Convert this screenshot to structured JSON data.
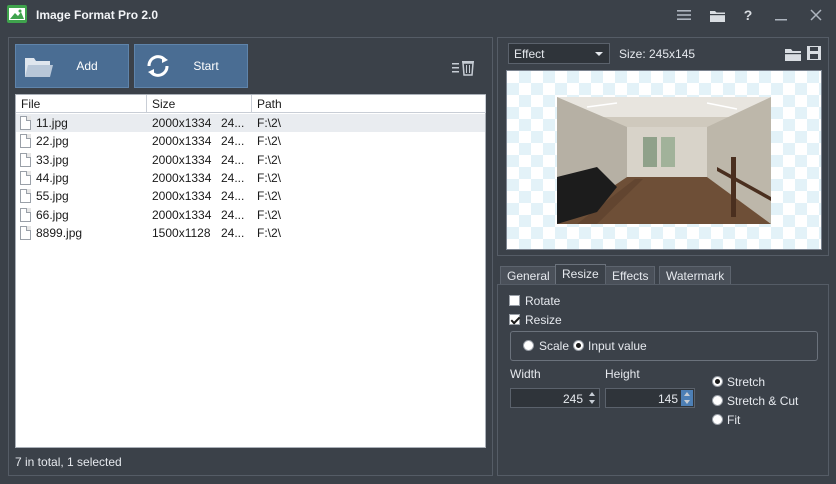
{
  "app": {
    "title": "Image Format Pro 2.0"
  },
  "toolbar": {
    "add_label": "Add",
    "start_label": "Start"
  },
  "file_table": {
    "columns": [
      "File",
      "Size",
      "Path"
    ],
    "rows": [
      {
        "file": "11.jpg",
        "size": "2000x1334",
        "bytes": "24...",
        "path": "F:\\2\\"
      },
      {
        "file": "22.jpg",
        "size": "2000x1334",
        "bytes": "24...",
        "path": "F:\\2\\"
      },
      {
        "file": "33.jpg",
        "size": "2000x1334",
        "bytes": "24...",
        "path": "F:\\2\\"
      },
      {
        "file": "44.jpg",
        "size": "2000x1334",
        "bytes": "24...",
        "path": "F:\\2\\"
      },
      {
        "file": "55.jpg",
        "size": "2000x1334",
        "bytes": "24...",
        "path": "F:\\2\\"
      },
      {
        "file": "66.jpg",
        "size": "2000x1334",
        "bytes": "24...",
        "path": "F:\\2\\"
      },
      {
        "file": "8899.jpg",
        "size": "1500x1128",
        "bytes": "24...",
        "path": "F:\\2\\"
      }
    ],
    "selected_index": 0
  },
  "status": {
    "text": "7 in total, 1 selected"
  },
  "preview": {
    "mode_select": "Effect",
    "size_label": "Size: 245x145"
  },
  "tabs": [
    "General",
    "Resize",
    "Effects",
    "Watermark"
  ],
  "active_tab": "Resize",
  "resize": {
    "rotate_label": "Rotate",
    "rotate_checked": false,
    "resize_label": "Resize",
    "resize_checked": true,
    "scale_label": "Scale",
    "input_value_label": "Input value",
    "mode": "Input value",
    "width_label": "Width",
    "height_label": "Height",
    "width_value": "245",
    "height_value": "145",
    "fit_options": [
      "Stretch",
      "Stretch & Cut",
      "Fit"
    ],
    "fit_selected": "Stretch"
  },
  "icons": {
    "menu": "menu-icon",
    "folder": "folder-icon",
    "help": "help-icon",
    "minimize": "minimize-icon",
    "close": "close-icon"
  },
  "colors": {
    "accent": "#4a6d93",
    "background": "#3b4149"
  }
}
